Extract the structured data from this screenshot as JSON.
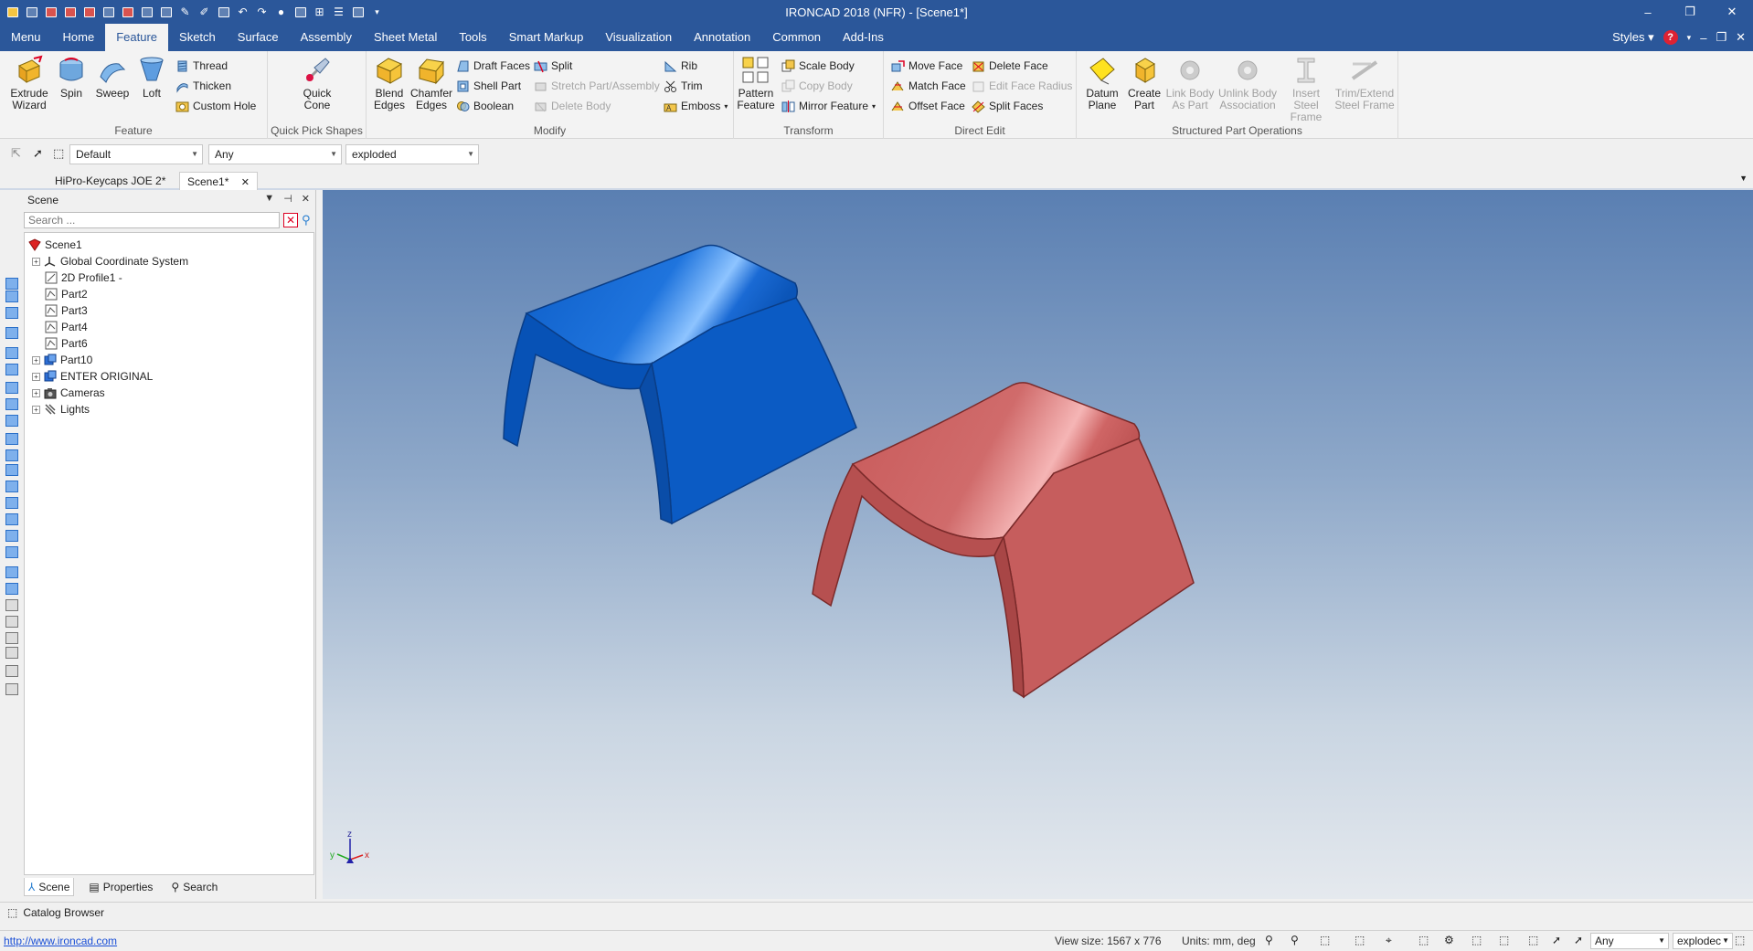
{
  "title": "IRONCAD 2018 (NFR) - [Scene1*]",
  "window_controls": [
    "–",
    "❐",
    "✕"
  ],
  "ribbon_tabs": [
    "Menu",
    "Home",
    "Feature",
    "Sketch",
    "Surface",
    "Assembly",
    "Sheet Metal",
    "Tools",
    "Smart Markup",
    "Visualization",
    "Annotation",
    "Common",
    "Add-Ins"
  ],
  "active_tab": "Feature",
  "styles_label": "Styles",
  "groups": {
    "feature": {
      "label": "Feature",
      "extrude": "Extrude Wizard",
      "spin": "Spin",
      "sweep": "Sweep",
      "loft": "Loft",
      "thread": "Thread",
      "thicken": "Thicken",
      "custom_hole": "Custom Hole"
    },
    "quick_pick": {
      "label": "Quick Pick Shapes",
      "quick_cone": "Quick Cone"
    },
    "modify": {
      "label": "Modify",
      "blend_edges": "Blend Edges",
      "chamfer_edges": "Chamfer Edges",
      "draft_faces": "Draft Faces",
      "shell_part": "Shell Part",
      "boolean": "Boolean",
      "split": "Split",
      "stretch": "Stretch Part/Assembly",
      "delete_body": "Delete Body",
      "rib": "Rib",
      "trim": "Trim",
      "emboss": "Emboss"
    },
    "transform": {
      "label": "Transform",
      "pattern_feature": "Pattern Feature",
      "scale_body": "Scale Body",
      "copy_body": "Copy Body",
      "mirror_feature": "Mirror Feature"
    },
    "direct_edit": {
      "label": "Direct Edit",
      "move_face": "Move Face",
      "match_face": "Match Face",
      "offset_face": "Offset Face",
      "delete_face": "Delete Face",
      "edit_face_radius": "Edit Face Radius",
      "split_faces": "Split Faces"
    },
    "structured": {
      "label": "Structured Part Operations",
      "datum_plane": "Datum Plane",
      "create_part": "Create Part",
      "link_body": "Link Body As Part",
      "unlink_body": "Unlink Body Association",
      "insert_steel": "Insert Steel Frame",
      "trim_extend": "Trim/Extend Steel Frame"
    }
  },
  "selection_bar": {
    "style": "Default",
    "filter": "Any",
    "config": "exploded"
  },
  "doc_tabs": [
    "HiPro-Keycaps JOE 2*",
    "Scene1*"
  ],
  "scene_panel": {
    "title": "Scene",
    "search_placeholder": "Search ...",
    "tree": [
      "Scene1",
      "Global Coordinate System",
      "2D Profile1 -",
      "Part2",
      "Part3",
      "Part4",
      "Part6",
      "Part10",
      "ENTER ORIGINAL",
      "Cameras",
      "Lights"
    ],
    "tabs": [
      "Scene",
      "Properties",
      "Search"
    ]
  },
  "axes": {
    "x": "x",
    "y": "y",
    "z": "z"
  },
  "catalog_browser": "Catalog Browser",
  "status": {
    "link": "http://www.ironcad.com",
    "view_size": "View size: 1567 x 776",
    "units": "Units: mm, deg",
    "filter": "Any",
    "config": "explodec"
  },
  "colors": {
    "accent": "#2b579a",
    "blue_part": "#0a5cc4",
    "red_part": "#c96060"
  }
}
